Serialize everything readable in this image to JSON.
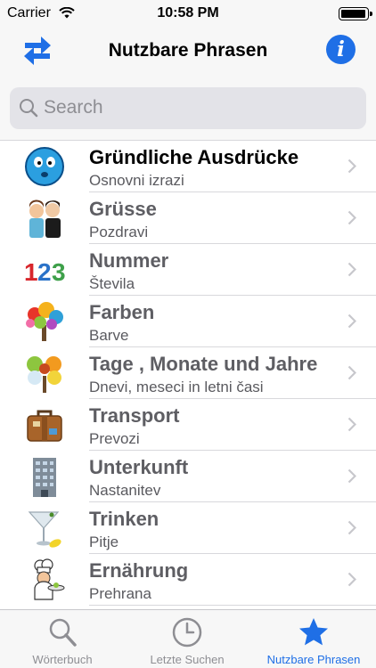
{
  "status_bar": {
    "carrier": "Carrier",
    "time": "10:58 PM"
  },
  "nav": {
    "title": "Nutzbare Phrasen",
    "left_icon": "swap-arrows-icon",
    "right_icon": "info-icon"
  },
  "search": {
    "placeholder": "Search",
    "value": ""
  },
  "rows": [
    {
      "title": "Gründliche Ausdrücke",
      "subtitle": "Osnovni izrazi",
      "icon": "smiley-face-icon"
    },
    {
      "title": "Grüsse",
      "subtitle": "Pozdravi",
      "icon": "greeting-people-icon"
    },
    {
      "title": "Nummer",
      "subtitle": "Števila",
      "icon": "numbers-icon",
      "icon_text": "123"
    },
    {
      "title": "Farben",
      "subtitle": "Barve",
      "icon": "colorful-tree-icon"
    },
    {
      "title": "Tage , Monate und Jahre",
      "subtitle": "Dnevi, meseci in letni časi",
      "icon": "seasons-tree-icon"
    },
    {
      "title": "Transport",
      "subtitle": "Prevozi",
      "icon": "suitcase-icon"
    },
    {
      "title": "Unterkunft",
      "subtitle": "Nastanitev",
      "icon": "building-icon"
    },
    {
      "title": "Trinken",
      "subtitle": "Pitje",
      "icon": "cocktail-icon"
    },
    {
      "title": "Ernährung",
      "subtitle": "Prehrana",
      "icon": "chef-icon"
    }
  ],
  "tabs": [
    {
      "label": "Wörterbuch",
      "icon": "magnifier-icon",
      "active": false
    },
    {
      "label": "Letzte Suchen",
      "icon": "clock-icon",
      "active": false
    },
    {
      "label": "Nutzbare Phrasen",
      "icon": "star-icon",
      "active": true
    }
  ],
  "colors": {
    "accent": "#1f6fe6",
    "inactive": "#8e8e93",
    "bar_bg": "#f7f7f7"
  }
}
